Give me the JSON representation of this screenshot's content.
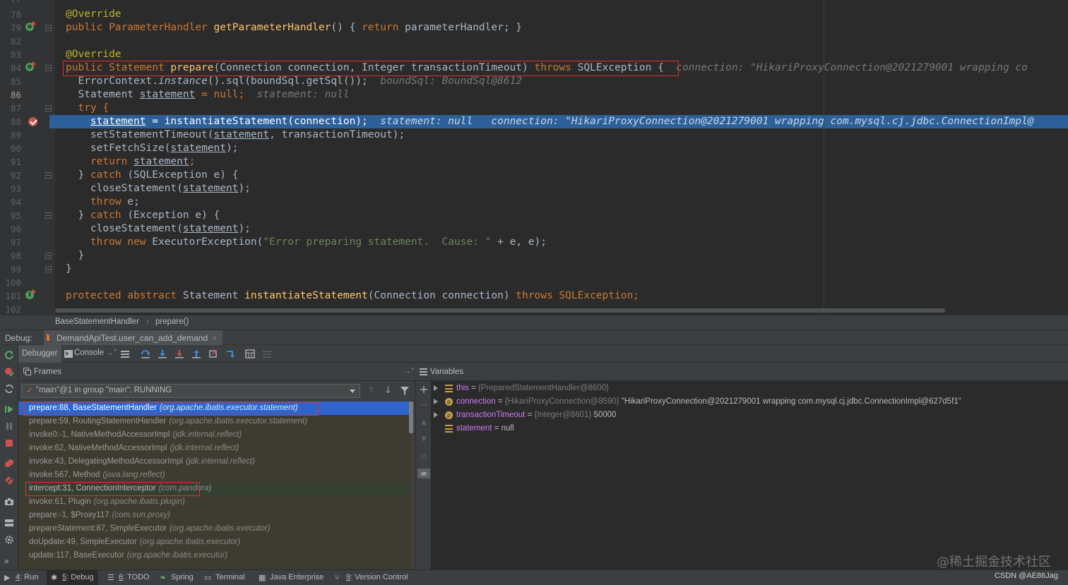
{
  "editor": {
    "line_numbers": [
      "77",
      "78",
      "79",
      "82",
      "83",
      "84",
      "85",
      "86",
      "87",
      "88",
      "89",
      "90",
      "91",
      "92",
      "93",
      "94",
      "95",
      "96",
      "97",
      "98",
      "99",
      "100",
      "101",
      "102"
    ],
    "lines": {
      "l78": "@Override",
      "l79_a": "public ParameterHandler ",
      "l79_fn": "getParameterHandler",
      "l79_b": "() { ",
      "l79_ret": "return",
      "l79_c": " parameterHandler; }",
      "l83": "@Override",
      "l84_a": "public Statement ",
      "l84_fn": "prepare",
      "l84_b": "(Connection connection, Integer transactionTimeout) ",
      "l84_throws": "throws",
      "l84_c": " SQLException {",
      "l84_hint": "connection: \"HikariProxyConnection@2021279001 wrapping co",
      "l85_a": "ErrorContext.",
      "l85_it": "instance",
      "l85_b": "().sql(boundSql.getSql());",
      "l85_hint": "boundSql: BoundSql@8612",
      "l86_a": "Statement ",
      "l86_var": "statement",
      "l86_b": " = null;",
      "l86_hint": "statement: null",
      "l87": "try {",
      "l88_var": "statement",
      "l88_b": " = instantiateStatement(connection);",
      "l88_hint": "statement: null   connection: \"HikariProxyConnection@2021279001 wrapping com.mysql.cj.jdbc.ConnectionImpl@",
      "l89_a": "setStatementTimeout(",
      "l89_var": "statement",
      "l89_b": ", transactionTimeout);",
      "l90_a": "setFetchSize(",
      "l90_var": "statement",
      "l90_b": ");",
      "l91_ret": "return ",
      "l91_var": "statement",
      "l91_b": ";",
      "l92_a": "} ",
      "l92_kw": "catch",
      "l92_b": " (SQLException e) {",
      "l93_a": "closeStatement(",
      "l93_var": "statement",
      "l93_b": ");",
      "l94_kw": "throw",
      "l94_b": " e;",
      "l95_a": "} ",
      "l95_kw": "catch",
      "l95_b": " (Exception e) {",
      "l96_a": "closeStatement(",
      "l96_var": "statement",
      "l96_b": ");",
      "l97_kw": "throw new",
      "l97_a": " ExecutorException(",
      "l97_str": "\"Error preparing statement.  Cause: \"",
      "l97_b": " + e, e);",
      "l98": "}",
      "l99": "}",
      "l101_kw": "protected abstract",
      "l101_a": " Statement ",
      "l101_fn": "instantiateStatement",
      "l101_b": "(Connection connection) ",
      "l101_throws": "throws",
      "l101_c": " SQLException;"
    }
  },
  "breadcrumb": {
    "class": "BaseStatementHandler",
    "method": "prepare()"
  },
  "debug": {
    "label": "Debug:",
    "tab": "DemandApiTest.user_can_add_demand",
    "tab_close": "×",
    "debugger_tab": "Debugger",
    "console_tab": "Console",
    "frames_title": "Frames",
    "variables_title": "Variables",
    "thread": "\"main\"@1 in group \"main\": RUNNING",
    "frames": [
      {
        "method": "prepare:88, BaseStatementHandler",
        "pkg": "(org.apache.ibatis.executor.statement)"
      },
      {
        "method": "prepare:59, RoutingStatementHandler",
        "pkg": "(org.apache.ibatis.executor.statement)"
      },
      {
        "method": "invoke0:-1, NativeMethodAccessorImpl",
        "pkg": "(jdk.internal.reflect)"
      },
      {
        "method": "invoke:62, NativeMethodAccessorImpl",
        "pkg": "(jdk.internal.reflect)"
      },
      {
        "method": "invoke:43, DelegatingMethodAccessorImpl",
        "pkg": "(jdk.internal.reflect)"
      },
      {
        "method": "invoke:567, Method",
        "pkg": "(java.lang.reflect)"
      },
      {
        "method": "intercept:31, ConnectionInterceptor",
        "pkg": "(com.pandora)"
      },
      {
        "method": "invoke:61, Plugin",
        "pkg": "(org.apache.ibatis.plugin)"
      },
      {
        "method": "prepare:-1, $Proxy117",
        "pkg": "(com.sun.proxy)"
      },
      {
        "method": "prepareStatement:87, SimpleExecutor",
        "pkg": "(org.apache.ibatis.executor)"
      },
      {
        "method": "doUpdate:49, SimpleExecutor",
        "pkg": "(org.apache.ibatis.executor)"
      },
      {
        "method": "update:117, BaseExecutor",
        "pkg": "(org.apache.ibatis.executor)"
      }
    ],
    "variables": [
      {
        "name": "this",
        "eq": " = ",
        "type": "{PreparedStatementHandler@8600}",
        "value": ""
      },
      {
        "name": "connection",
        "eq": " = ",
        "type": "{HikariProxyConnection@8590}",
        "value": " \"HikariProxyConnection@2021279001 wrapping com.mysql.cj.jdbc.ConnectionImpl@627d5f1\""
      },
      {
        "name": "transactionTimeout",
        "eq": " = ",
        "type": "{Integer@8601}",
        "value": " 50000"
      },
      {
        "name": "statement",
        "eq": " = ",
        "type": "",
        "value": "null"
      }
    ]
  },
  "bottom_tabs": {
    "run_num": "4",
    "run": ": Run",
    "debug_num": "5",
    "debug": ": Debug",
    "todo_num": "6",
    "todo": ": TODO",
    "spring": "Spring",
    "terminal": "Terminal",
    "javaee": "Java Enterprise",
    "vcs_num": "9",
    "vcs": ": Version Control"
  },
  "watermark": "@稀土掘金技术社区",
  "credit": "CSDN @AE86Jag",
  "colors": {
    "exec_line": "#2d6099",
    "selected_frame": "#2f65ca",
    "highlight_box": "#e0302c",
    "keyword": "#cc7832"
  }
}
